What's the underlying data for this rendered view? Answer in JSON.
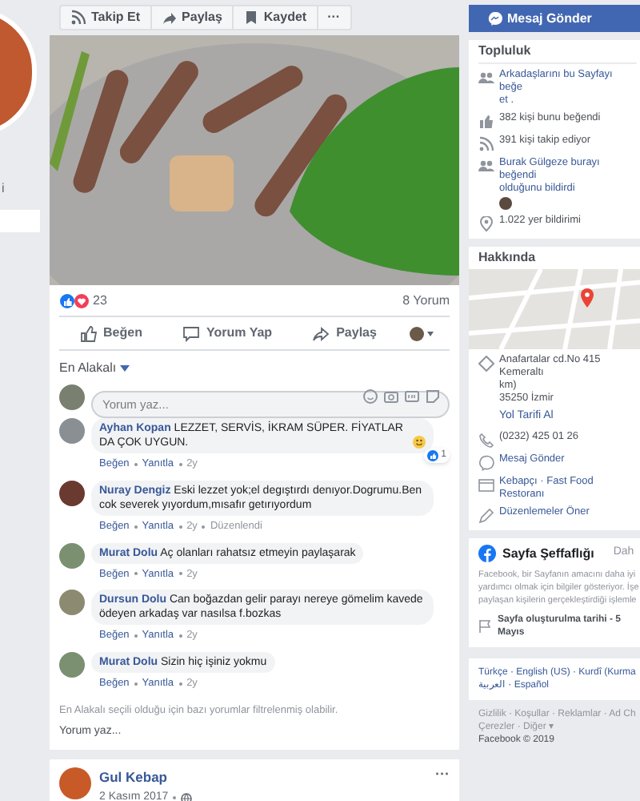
{
  "left_column": {
    "text": "i"
  },
  "page_actions": [
    {
      "label": "Takip Et",
      "kind": "follow"
    },
    {
      "label": "Paylaş",
      "kind": "share"
    },
    {
      "label": "Kaydet",
      "kind": "save"
    },
    {
      "label": "···",
      "kind": "more"
    }
  ],
  "message_button": "Mesaj Gönder",
  "post": {
    "reactions_count": "23",
    "comments_count": "8 Yorum",
    "actions": [
      {
        "label": "Beğen",
        "kind": "like"
      },
      {
        "label": "Yorum Yap",
        "kind": "comment"
      },
      {
        "label": "Paylaş",
        "kind": "share"
      }
    ],
    "sort": "En Alakalı",
    "comment_placeholder": "Yorum yaz...",
    "comments": [
      {
        "author": "Ayhan Kopan",
        "text": "LEZZET, SERVİS, İKRAM SÜPER. FİYATLAR DA ÇOK UYGUN.",
        "smiley": true,
        "meta": [
          "Beğen",
          "Yanıtla",
          "2y"
        ],
        "likes": "1"
      },
      {
        "author": "Nuray Dengiz",
        "text": "Eski lezzet yok;el degıştırdı denıyor.Dogrumu.Ben cok severek yıyordum,mısafır getırıyordum",
        "smiley": false,
        "meta": [
          "Beğen",
          "Yanıtla",
          "2y",
          "Düzenlendi"
        ]
      },
      {
        "author": "Murat Dolu",
        "text": "Aç olanları rahatsız etmeyin paylaşarak",
        "smiley": false,
        "meta": [
          "Beğen",
          "Yanıtla",
          "2y"
        ]
      },
      {
        "author": "Dursun Dolu",
        "text": "Can boğazdan gelir parayı nereye gömelim kavede ödeyen arkadaş var nasılsa f.bozkas",
        "smiley": false,
        "meta": [
          "Beğen",
          "Yanıtla",
          "2y"
        ]
      },
      {
        "author": "Murat Dolu",
        "text": "Sizin hiç işiniz yokmu",
        "smiley": false,
        "meta": [
          "Beğen",
          "Yanıtla",
          "2y"
        ]
      }
    ],
    "filter_note": "En Alakalı seçili olduğu için bazı yorumlar filtrelenmiş olabilir.",
    "write_comment": "Yorum yaz..."
  },
  "next_post": {
    "author": "Gul Kebap",
    "date": "2 Kasım 2017",
    "more": "···"
  },
  "community": {
    "title": "Topluluk",
    "items": [
      {
        "kind": "friends",
        "lines": [
          "Arkadaşlarını bu Sayfayı beğe",
          "et ."
        ],
        "link": true
      },
      {
        "kind": "like",
        "lines": [
          "382 kişi bunu beğendi"
        ],
        "link": false
      },
      {
        "kind": "follow",
        "lines": [
          "391 kişi takip ediyor"
        ],
        "link": false
      },
      {
        "kind": "friends",
        "lines": [
          "Burak Gülgeze burayı beğendi",
          "olduğunu bildirdi"
        ],
        "link": true,
        "avatar": true
      },
      {
        "kind": "checkin",
        "lines": [
          "1.022 yer bildirimi"
        ],
        "link": false
      }
    ]
  },
  "about": {
    "title": "Hakkında",
    "items": [
      {
        "kind": "address",
        "lines": [
          "Anafartalar cd.No 415 Kemeraltı",
          "km)",
          "35250 İzmir"
        ],
        "sub": "Yol Tarifi Al"
      },
      {
        "kind": "phone",
        "lines": [
          "(0232) 425 01 26"
        ]
      },
      {
        "kind": "messenger",
        "lines": [
          "Mesaj Gönder"
        ]
      },
      {
        "kind": "category",
        "lines": [
          "Kebapçı · Fast Food Restoranı"
        ]
      },
      {
        "kind": "edit",
        "lines": [
          "Düzenlemeler Öner"
        ]
      }
    ]
  },
  "transparency": {
    "title": "Sayfa Şeffaflığı",
    "more": "Dah",
    "description": [
      "Facebook, bir Sayfanın amacını daha iyi",
      "yardımcı olmak için bilgiler gösteriyor. İşe",
      "paylaşan kişilerin gerçekleştirdiği işlemle"
    ],
    "created": "Sayfa oluşturulma tarihi - 5 Mayıs"
  },
  "languages": [
    "Türkçe · English (US) · Kurdî (Kurma",
    "العربية · Español"
  ],
  "footer": [
    "Gizlilik · Koşullar · Reklamlar · Ad Ch",
    "Çerezler · Diğer ▾",
    "Facebook © 2019"
  ]
}
